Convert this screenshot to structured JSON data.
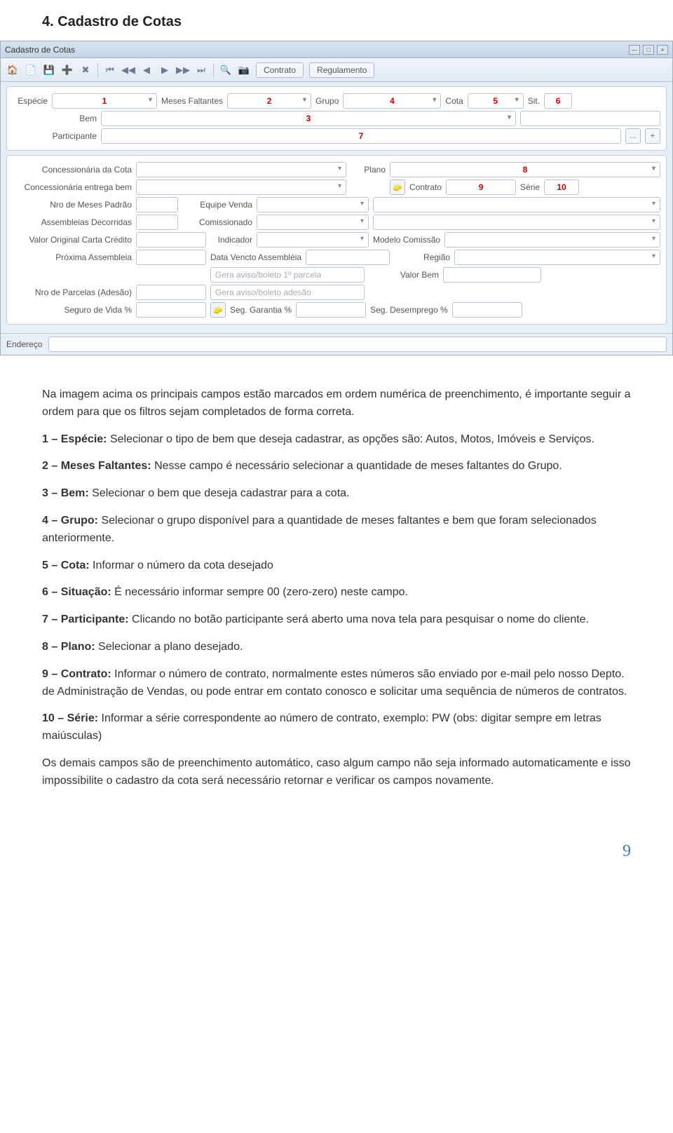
{
  "doc": {
    "title": "4.  Cadastro de Cotas",
    "intro": "Na imagem acima os principais campos estão marcados em ordem numérica de preenchimento, é importante seguir a ordem para que os filtros sejam completados de forma correta.",
    "p1a": "1 – Espécie: ",
    "p1b": "Selecionar o tipo de bem que deseja cadastrar, as opções são: Autos, Motos, Imóveis e Serviços.",
    "p2a": "2 – Meses Faltantes: ",
    "p2b": "Nesse campo é necessário selecionar a quantidade de meses faltantes do Grupo.",
    "p3a": "3 – Bem: ",
    "p3b": "Selecionar o bem que deseja cadastrar para a cota.",
    "p4a": "4 – Grupo: ",
    "p4b": "Selecionar o grupo disponível para a quantidade de meses faltantes e bem que foram selecionados anteriormente.",
    "p5a": "5 – Cota: ",
    "p5b": "Informar o número da cota desejado",
    "p6a": "6 – Situação: ",
    "p6b": "É necessário informar sempre 00 (zero-zero) neste campo.",
    "p7a": "7 – Participante: ",
    "p7b": "Clicando no botão participante será aberto uma nova tela para pesquisar o nome do cliente.",
    "p8a": "8 – Plano: ",
    "p8b": "Selecionar a plano desejado.",
    "p9a": "9 – Contrato: ",
    "p9b": "Informar o número de contrato, normalmente estes números são enviado por e-mail pelo nosso Depto. de Administração de Vendas, ou pode entrar em contato conosco e solicitar uma sequência de números de contratos.",
    "p10a": "10 – Série: ",
    "p10b": "Informar a série correspondente ao número de contrato, exemplo: PW (obs: digitar sempre em letras maiúsculas)",
    "outro": "Os demais campos são de preenchimento automático, caso algum campo não seja informado automaticamente e isso impossibilite o cadastro da cota será necessário retornar e verificar os campos novamente.",
    "page_number": "9"
  },
  "window": {
    "title": "Cadastro de Cotas",
    "win_min": "—",
    "win_max": "□",
    "win_close": "×",
    "toolbar": {
      "contrato": "Contrato",
      "regulamento": "Regulamento"
    },
    "labels": {
      "especie": "Espécie",
      "meses_faltantes": "Meses Faltantes",
      "grupo": "Grupo",
      "cota": "Cota",
      "sit": "Sit.",
      "bem": "Bem",
      "participante": "Participante",
      "concessionaria_cota": "Concessionária da Cota",
      "plano": "Plano",
      "concessionaria_entrega": "Concessionária entrega bem",
      "contrato": "Contrato",
      "serie": "Série",
      "nro_meses_padrao": "Nro de Meses Padrão",
      "equipe_venda": "Equipe Venda",
      "assembleias_decorridas": "Assembleias Decorridas",
      "comissionado": "Comissionado",
      "valor_original_carta": "Valor Original Carta Crédito",
      "indicador": "Indicador",
      "modelo_comissao": "Modelo Comissão",
      "proxima_assembleia": "Próxima Assembleia",
      "data_vencto": "Data Vencto Assembléia",
      "regiao": "Região",
      "gera_aviso_parcela": "Gera aviso/boleto 1º parcela",
      "valor_bem": "Valor Bem",
      "nro_parcelas_adesao": "Nro de Parcelas (Adesão)",
      "gera_aviso_adesao": "Gera aviso/boleto adesão",
      "seguro_vida": "Seguro de Vida %",
      "seg_garantia": "Seg. Garantia %",
      "seg_desemprego": "Seg. Desemprego %",
      "endereco": "Endereço",
      "browse": "...",
      "plus": "+"
    },
    "markers": {
      "m1": "1",
      "m2": "2",
      "m3": "3",
      "m4": "4",
      "m5": "5",
      "m6": "6",
      "m7": "7",
      "m8": "8",
      "m9": "9",
      "m10": "10"
    }
  }
}
